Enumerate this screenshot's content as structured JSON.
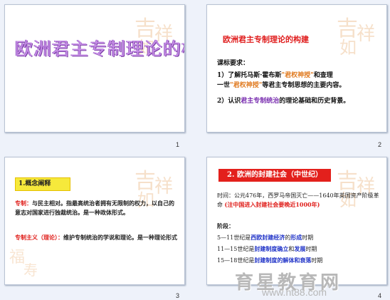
{
  "slides": [
    {
      "number": "1",
      "title": "欧洲君主专制理论的构建"
    },
    {
      "number": "2",
      "heading": "欧洲君主专制理论的构建",
      "req_label": "课标要求：",
      "p1_a": "1）了解托马斯·霍布斯",
      "p1_em1": "\"君权神授\"",
      "p1_b": "和查理",
      "p1_c": "一世",
      "p1_em2": "\"君权神授\"",
      "p1_d": "等君主专制思想的主要内容。",
      "p2_a": "2）认识",
      "p2_em": "君主专制统治",
      "p2_b": "的理论基础和历史背景。"
    },
    {
      "number": "3",
      "tag": "1.概念阐释",
      "def1_key": "专制：",
      "def1_text": "与民主相对。指最高统治者拥有无限制的权力，以自己的意志对国家进行独裁统治。是一种政体形式。",
      "def2_key": "专制主义（理论）：",
      "def2_text": "维护专制统治的学说和理论。是一种理论形式"
    },
    {
      "number": "4",
      "heading": "2. 欧洲的封建社会（中世纪）",
      "time_a": "时间：公元476年，西罗马帝国灭亡——1640年英国资产阶级革命",
      "time_hl": "(注中国进入封建社会要晚近1000年)",
      "stage_label": "阶段：",
      "stages": [
        {
          "a": "5—11世纪是",
          "em1": "西欧封建经济",
          "b": "的",
          "em2": "形成",
          "c": "时期"
        },
        {
          "a": "11—15世纪是",
          "em1": "封建制度确立",
          "b": "和",
          "em2": "发展",
          "c": "时期"
        },
        {
          "a": "15—18世纪是",
          "em1": "封建制度的",
          "b": "",
          "em2": "解体和衰落",
          "c": "时期"
        }
      ]
    }
  ],
  "watermark": {
    "logo": "育星教育网",
    "url": "www.ht88.com"
  }
}
